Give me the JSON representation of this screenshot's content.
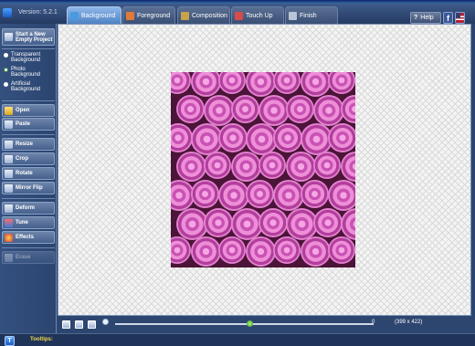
{
  "header": {
    "version": "Version: 5.2.1",
    "tabs": [
      {
        "label": "Background",
        "active": true,
        "icon": "background-icon",
        "color": "#4a9adf"
      },
      {
        "label": "Foreground",
        "active": false,
        "icon": "foreground-icon",
        "color": "#e07a3a"
      },
      {
        "label": "Composition",
        "active": false,
        "icon": "composition-icon",
        "color": "#c9a24a"
      },
      {
        "label": "Touch Up",
        "active": false,
        "icon": "touch-up-icon",
        "color": "#d94a4a"
      },
      {
        "label": "Finish",
        "active": false,
        "icon": "finish-icon",
        "color": "#b9c4d6"
      }
    ],
    "help": "Help"
  },
  "sidebar": {
    "new_project": [
      "Start a New",
      "Empty Project"
    ],
    "backgrounds": [
      {
        "label": [
          "Transparent",
          "Background"
        ],
        "selected": false
      },
      {
        "label": [
          "Photo",
          "Background"
        ],
        "selected": true
      },
      {
        "label": [
          "Artificial",
          "Background"
        ],
        "selected": false
      }
    ],
    "open": "Open",
    "paste": "Paste",
    "resize": "Resize",
    "crop": "Crop",
    "rotate": "Rotate",
    "mirror": "Mirror Flip",
    "deform": "Deform",
    "tune": "Tune",
    "effects": "Effects",
    "erase": "Erase"
  },
  "zoom": {
    "value": "0",
    "level": 0.52,
    "image_size": "(399 x 422)"
  },
  "footer": {
    "tooltips_label": "Tooltips:"
  },
  "colors": {
    "accent": "#4f83c4",
    "tooltip_text": "#f0d84a"
  }
}
